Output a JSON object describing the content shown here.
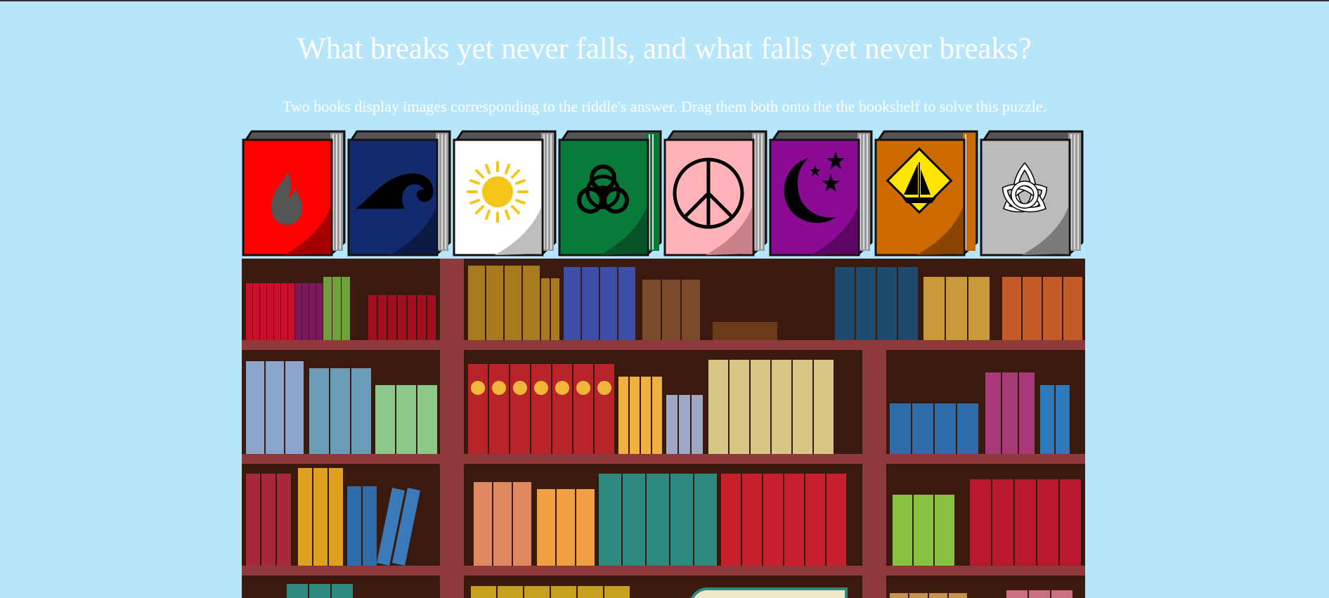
{
  "riddle": {
    "question": "What breaks yet never falls, and what falls yet never breaks?",
    "instructions": "Two books display images corresponding to the riddle's answer. Drag them both onto the the bookshelf to solve this puzzle."
  },
  "books": [
    {
      "name": "fire",
      "icon": "flame-icon",
      "cover": "#ff0000",
      "shade": "#a80000"
    },
    {
      "name": "wave",
      "icon": "wave-icon",
      "cover": "#142a6e",
      "shade": "#0c1a45"
    },
    {
      "name": "sun",
      "icon": "sun-icon",
      "cover": "#ffffff",
      "shade": "#bdbdbd"
    },
    {
      "name": "biohazard",
      "icon": "biohazard-icon",
      "cover": "#0a7a3b",
      "shade": "#075228"
    },
    {
      "name": "peace",
      "icon": "peace-icon",
      "cover": "#ffb2b8",
      "shade": "#c98088"
    },
    {
      "name": "night",
      "icon": "moon-stars-icon",
      "cover": "#8a0a96",
      "shade": "#5a0662"
    },
    {
      "name": "sailboat",
      "icon": "sailboat-sign-icon",
      "cover": "#cc6a00",
      "shade": "#8a4500"
    },
    {
      "name": "triquetra",
      "icon": "triquetra-icon",
      "cover": "#bbbbbb",
      "shade": "#7a7a7a"
    }
  ],
  "bookshelf": {
    "frame_color": "#8f3a3a",
    "back_color": "#3a1a0e"
  }
}
